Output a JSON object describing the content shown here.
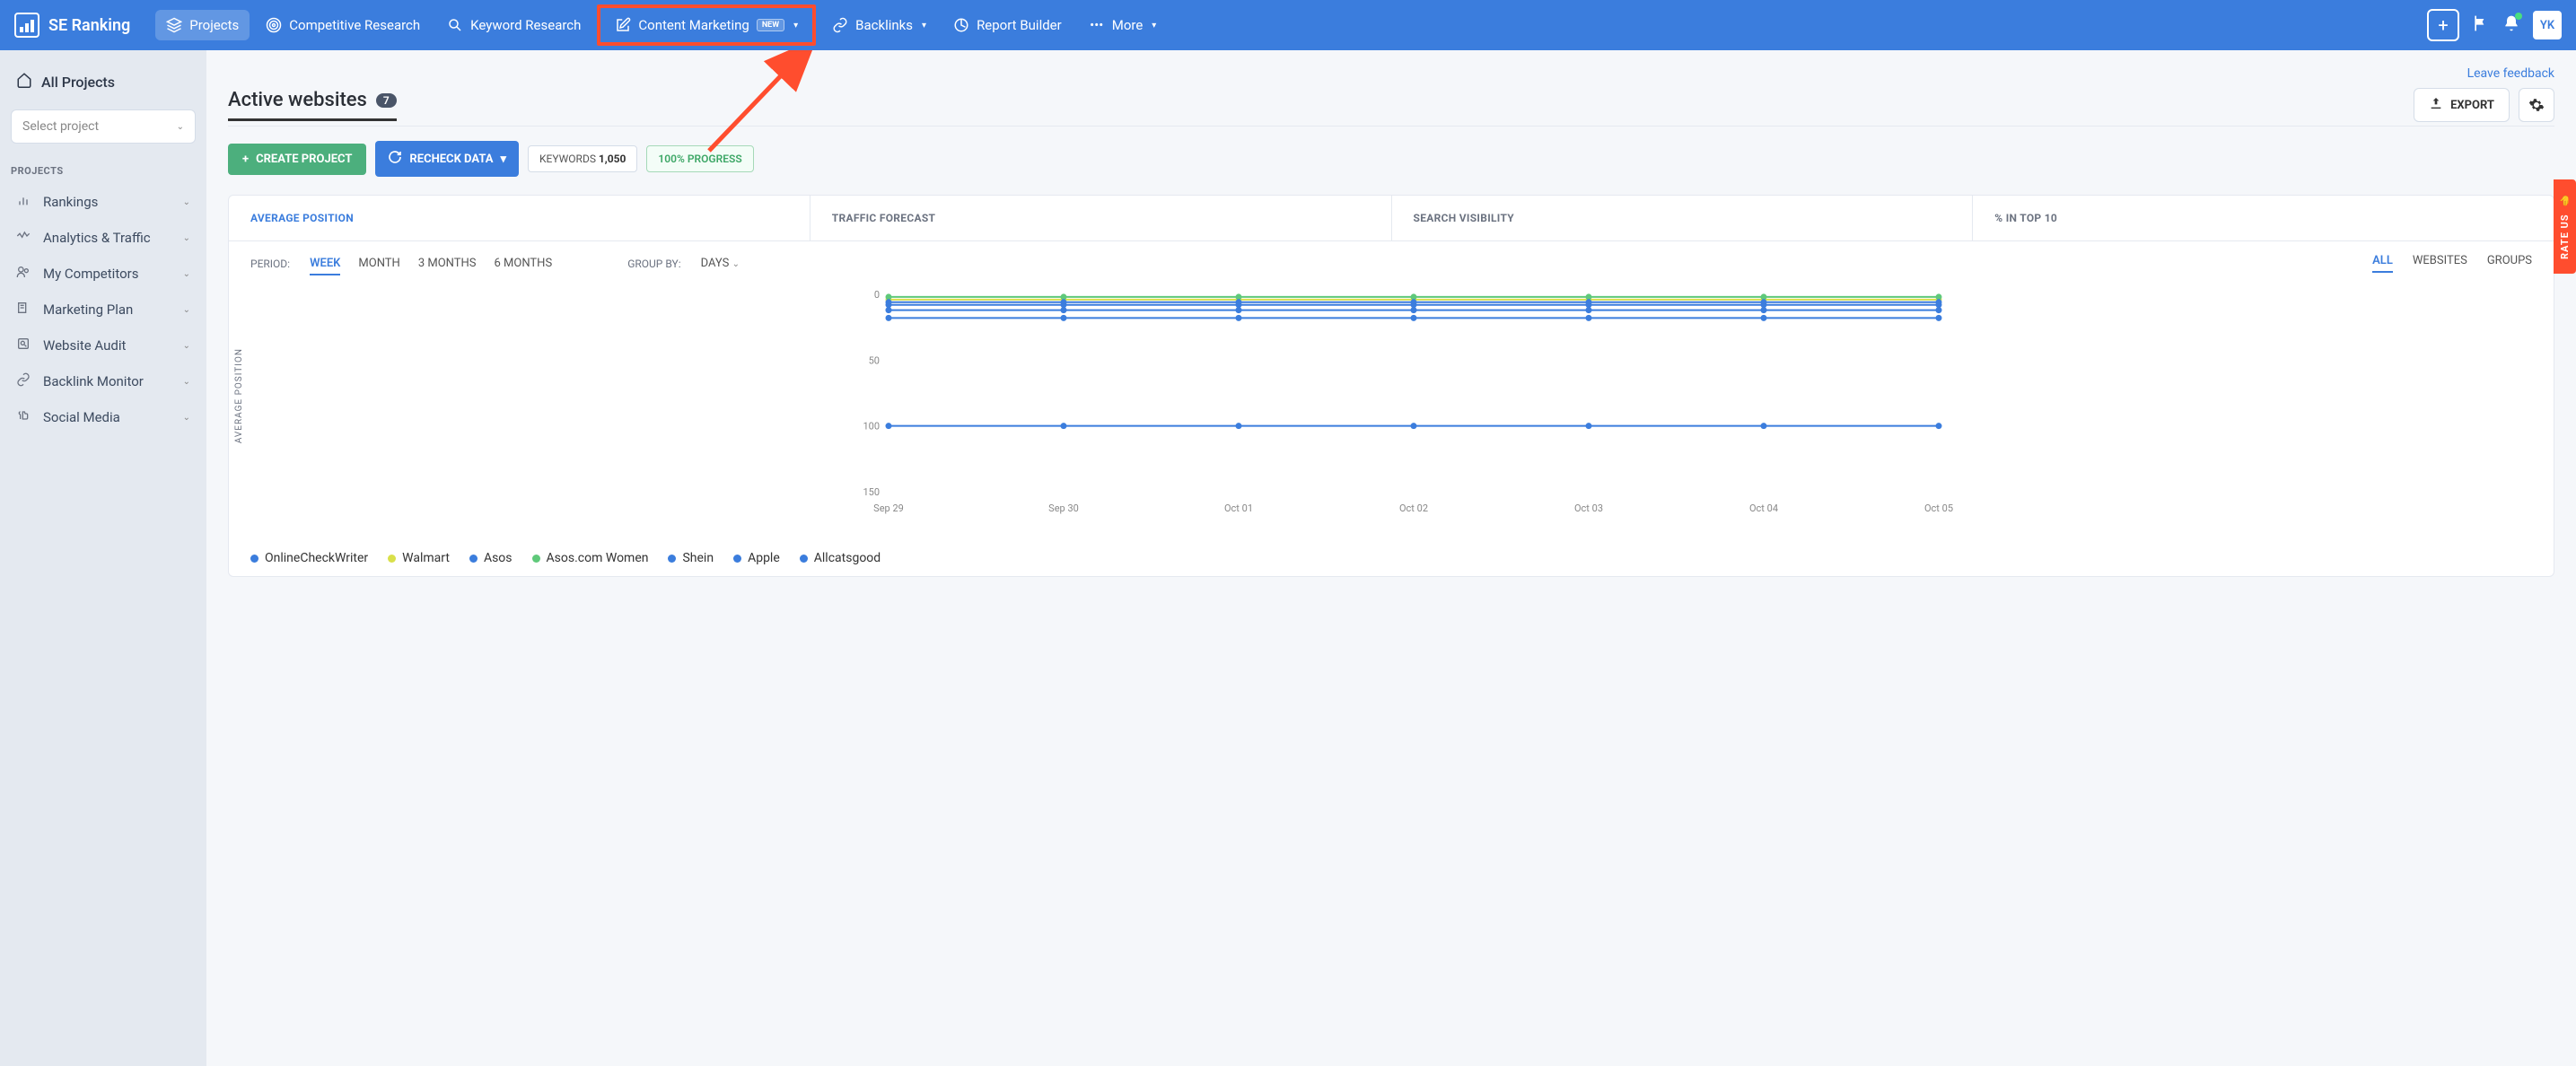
{
  "brand": "SE Ranking",
  "nav": {
    "projects": "Projects",
    "competitive": "Competitive Research",
    "keyword": "Keyword Research",
    "content": "Content Marketing",
    "content_badge": "NEW",
    "backlinks": "Backlinks",
    "report": "Report Builder",
    "more": "More"
  },
  "user_initials": "YK",
  "sidebar": {
    "all_projects": "All Projects",
    "select_placeholder": "Select project",
    "section_label": "PROJECTS",
    "items": [
      {
        "label": "Rankings"
      },
      {
        "label": "Analytics & Traffic"
      },
      {
        "label": "My Competitors"
      },
      {
        "label": "Marketing Plan"
      },
      {
        "label": "Website Audit"
      },
      {
        "label": "Backlink Monitor"
      },
      {
        "label": "Social Media"
      }
    ]
  },
  "feedback": "Leave feedback",
  "page": {
    "title": "Active websites",
    "count": "7",
    "export": "EXPORT",
    "create": "CREATE PROJECT",
    "recheck": "RECHECK DATA",
    "keywords_label": "KEYWORDS",
    "keywords_count": "1,050",
    "progress": "100%  PROGRESS"
  },
  "tabs": {
    "avg": "AVERAGE POSITION",
    "traffic": "TRAFFIC FORECAST",
    "visibility": "SEARCH VISIBILITY",
    "top10": "% IN TOP 10"
  },
  "filters": {
    "period_label": "PERIOD:",
    "period_opts": [
      "WEEK",
      "MONTH",
      "3 MONTHS",
      "6 MONTHS"
    ],
    "group_label": "GROUP BY:",
    "group_val": "DAYS",
    "right_opts": [
      "ALL",
      "WEBSITES",
      "GROUPS"
    ]
  },
  "rate_us": "RATE US",
  "chart_data": {
    "type": "line",
    "title": "",
    "xlabel": "",
    "ylabel": "AVERAGE POSITION",
    "ylim": [
      0,
      150
    ],
    "yticks": [
      0,
      50,
      100,
      150
    ],
    "categories": [
      "Sep 29",
      "Sep 30",
      "Oct 01",
      "Oct 02",
      "Oct 03",
      "Oct 04",
      "Oct 05"
    ],
    "series": [
      {
        "name": "OnlineCheckWriter",
        "color": "#3b7ddd",
        "values": [
          100,
          100,
          100,
          100,
          100,
          100,
          100
        ]
      },
      {
        "name": "Walmart",
        "color": "#d9e04a",
        "values": [
          4,
          4,
          4,
          4,
          4,
          4,
          4
        ]
      },
      {
        "name": "Asos",
        "color": "#3b7ddd",
        "values": [
          12,
          12,
          12,
          12,
          12,
          12,
          12
        ]
      },
      {
        "name": "Asos.com Women",
        "color": "#5fc97a",
        "values": [
          2,
          2,
          2,
          2,
          2,
          2,
          2
        ]
      },
      {
        "name": "Shein",
        "color": "#3b7ddd",
        "values": [
          18,
          18,
          18,
          18,
          18,
          18,
          18
        ]
      },
      {
        "name": "Apple",
        "color": "#3b7ddd",
        "values": [
          8,
          8,
          8,
          8,
          8,
          8,
          8
        ]
      },
      {
        "name": "Allcatsgood",
        "color": "#3b7ddd",
        "values": [
          6,
          6,
          6,
          6,
          6,
          6,
          6
        ]
      }
    ]
  }
}
